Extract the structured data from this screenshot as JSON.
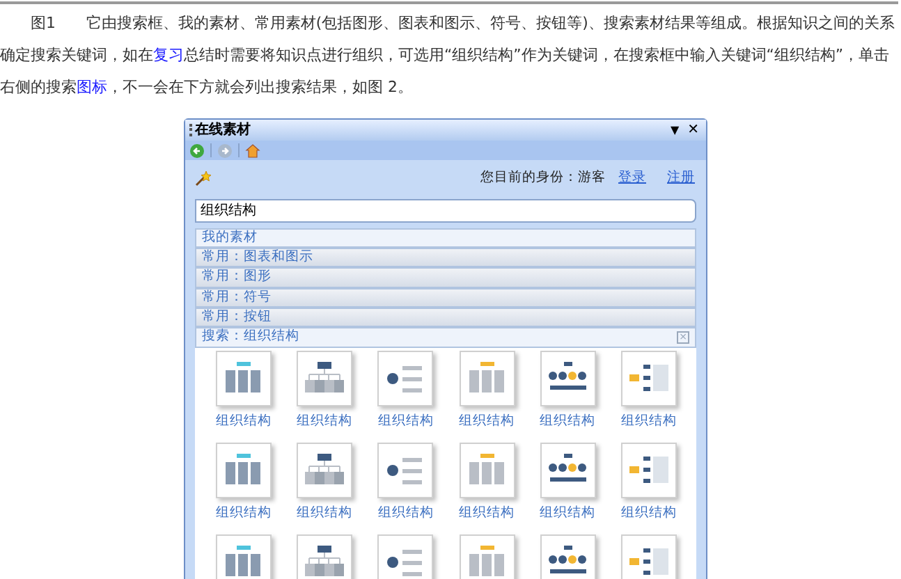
{
  "article": {
    "paragraph": [
      {
        "kind": "text",
        "text": "图1　　它由搜索框、我的素材、常用素材(包括图形、图表和图示、符号、按钮等)、搜索素材结果等组成。根据知识之间的关系确定搜索关键词，如在"
      },
      {
        "kind": "link",
        "text": "复习"
      },
      {
        "kind": "text",
        "text": "总结时需要将知识点进行组织，可选用“组织结构”作为关键词，在搜索框中输入关键词“组织结构”，单击右侧的搜索"
      },
      {
        "kind": "link",
        "text": "图标"
      },
      {
        "kind": "text",
        "text": "，不一会在下方就会列出搜索结果，如图 2。"
      }
    ]
  },
  "panel": {
    "title": "在线素材",
    "menu_glyph": "▼",
    "close_glyph": "✕",
    "toolbar": [
      {
        "kind": "back",
        "disabled": false
      },
      {
        "kind": "forward",
        "disabled": true
      },
      {
        "kind": "home",
        "disabled": false
      }
    ],
    "identity": "您目前的身份：游客",
    "login": "登录",
    "register": "注册",
    "search": {
      "value": "组织结构"
    },
    "sections": [
      {
        "label": "我的素材",
        "kind": "open"
      },
      {
        "label": "常用：图表和图示",
        "kind": "bar"
      },
      {
        "label": "常用：图形",
        "kind": "bar"
      },
      {
        "label": "常用：符号",
        "kind": "bar"
      },
      {
        "label": "常用：按钮",
        "kind": "bar"
      },
      {
        "label": "搜索：组织结构",
        "kind": "open",
        "closable": true
      }
    ],
    "section_close_glyph": "×",
    "results": [
      {
        "kind": "item",
        "label": "组织结构"
      },
      {
        "kind": "item",
        "label": "组织结构"
      },
      {
        "kind": "item",
        "label": "组织结构"
      },
      {
        "kind": "item",
        "label": "组织结构"
      },
      {
        "kind": "item",
        "label": "组织结构"
      },
      {
        "kind": "item",
        "label": "组织结构"
      },
      {
        "kind": "item",
        "label": "组织结构"
      },
      {
        "kind": "item",
        "label": "组织结构"
      },
      {
        "kind": "item",
        "label": "组织结构"
      },
      {
        "kind": "item",
        "label": "组织结构"
      },
      {
        "kind": "item",
        "label": "组织结构"
      },
      {
        "kind": "item",
        "label": "组织结构"
      },
      {
        "kind": "thumbnail"
      },
      {
        "kind": "thumbnail"
      },
      {
        "kind": "thumbnail"
      },
      {
        "kind": "thumbnail"
      },
      {
        "kind": "thumbnail"
      },
      {
        "kind": "thumbnail"
      }
    ]
  }
}
